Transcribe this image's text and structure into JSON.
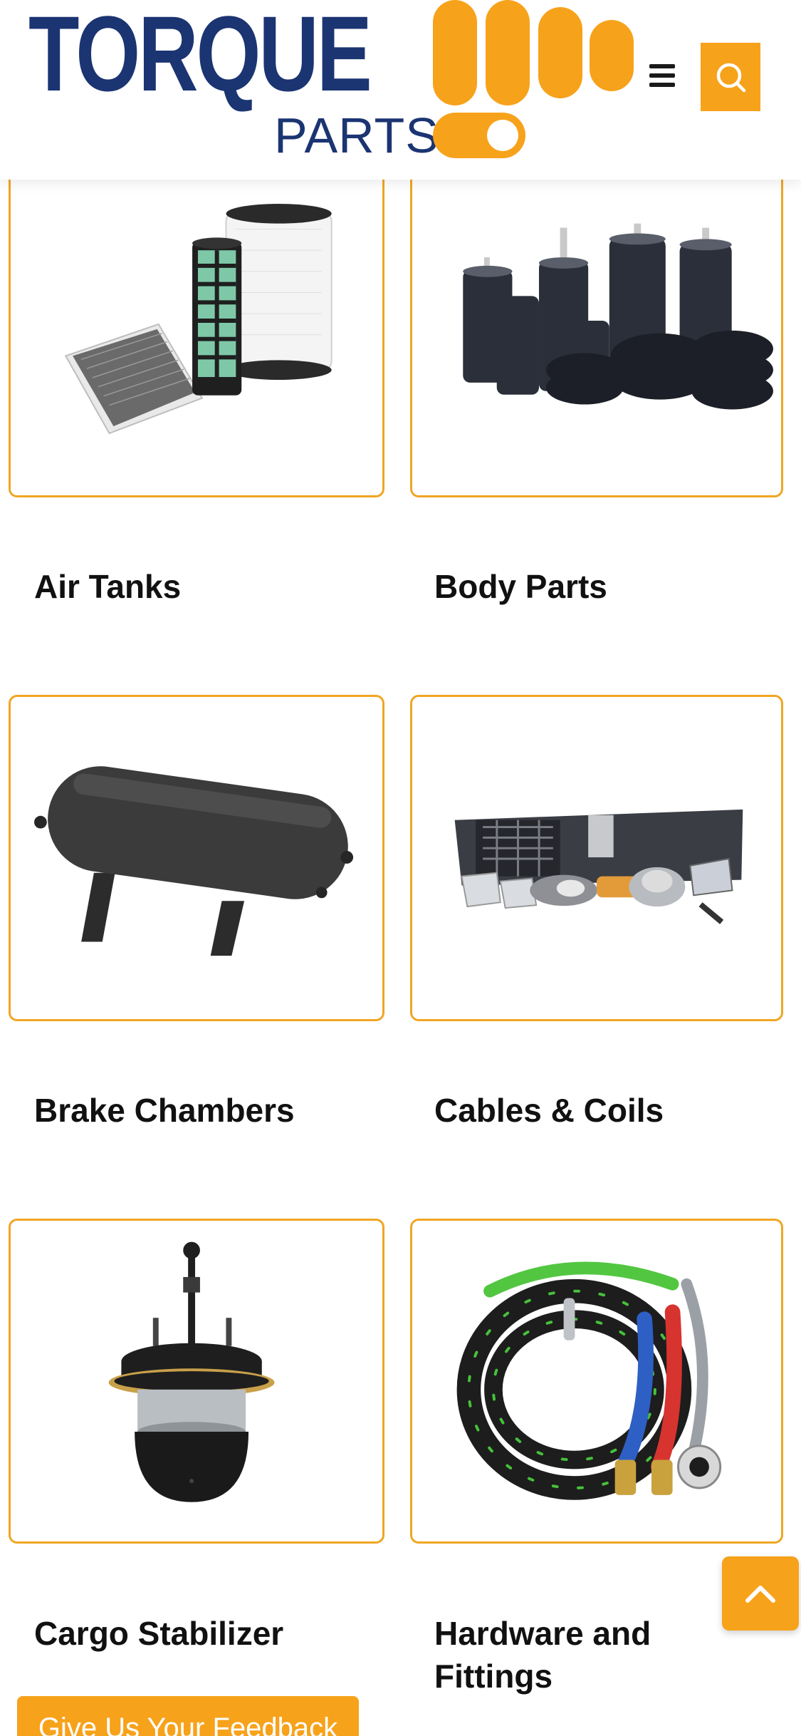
{
  "header": {
    "logo_word": "TORQUE",
    "logo_sub": "PARTS",
    "brand_color": "#1b3472",
    "accent_color": "#f7a21b",
    "menu_icon": "hamburger-menu-icon",
    "search_icon": "search-icon"
  },
  "products": [
    {
      "label": "",
      "image": "filters-image"
    },
    {
      "label": "",
      "image": "air-springs-image"
    },
    {
      "label": "Air Tanks",
      "image": "air-tank-image"
    },
    {
      "label": "Body Parts",
      "image": "body-parts-image"
    },
    {
      "label": "Brake Chambers",
      "image": "brake-chamber-image"
    },
    {
      "label": "Cables & Coils",
      "image": "cable-coil-image"
    },
    {
      "label": "Cargo Stabilizer",
      "image": ""
    },
    {
      "label": "Hardware and Fittings",
      "image": ""
    }
  ],
  "scroll_top": {
    "icon": "chevron-up-icon"
  },
  "feedback": {
    "label": "Give Us Your Feedback"
  }
}
